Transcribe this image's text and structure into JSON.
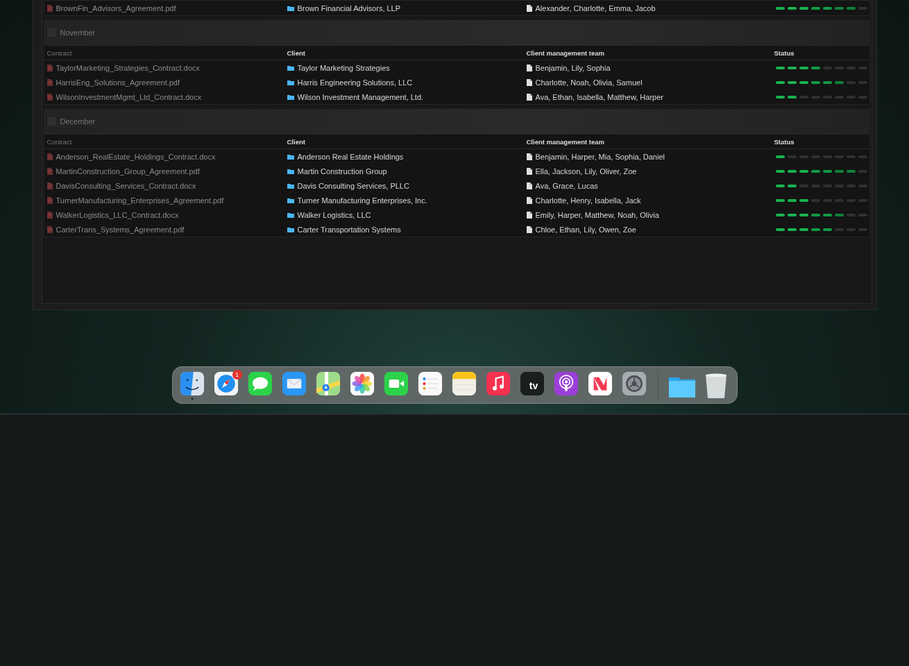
{
  "groups": [
    {
      "rows": [
        {
          "contract": "BrownFin_Advisors_Agreement.pdf",
          "client": "Brown Financial Advisors, LLP",
          "team": "Alexander, Charlotte, Emma, Jacob",
          "level": 0.875
        }
      ]
    },
    {
      "title": "November",
      "checked": false,
      "columns": [
        "Contract",
        "Client",
        "Client management team",
        "Status"
      ],
      "rows": [
        {
          "contract": "TaylorMarketing_Strategies_Contract.docx",
          "client": "Taylor Marketing Strategies",
          "team": "Benjamin, Lily, Sophia",
          "level": 0.5
        },
        {
          "contract": "HarrisEng_Solutions_Agreement.pdf",
          "client": "Harris Engineering Solutions, LLC",
          "team": "Charlotte, Noah, Olivia, Samuel",
          "level": 0.75
        },
        {
          "contract": "WilsonInvestmentMgmt_Ltd_Contract.docx",
          "client": "Wilson Investment Management, Ltd.",
          "team": "Ava, Ethan, Isabella, Matthew, Harper",
          "level": 0.25
        }
      ]
    },
    {
      "title": "December",
      "checked": false,
      "columns": [
        "Contract",
        "Client",
        "Client management team",
        "Status"
      ],
      "rows": [
        {
          "contract": "Anderson_RealEstate_Holdings_Contract.docx",
          "client": "Anderson Real Estate Holdings",
          "team": "Benjamin, Harper, Mia, Sophia, Daniel",
          "level": 0.125
        },
        {
          "contract": "MartinConstruction_Group_Agreement.pdf",
          "client": "Martin Construction Group",
          "team": "Ella, Jackson, Lily, Oliver, Zoe",
          "level": 0.875
        },
        {
          "contract": "DavisConsulting_Services_Contract.docx",
          "client": "Davis Consulting Services, PLLC",
          "team": "Ava, Grace, Lucas",
          "level": 0.25
        },
        {
          "contract": "TurnerManufacturing_Enterprises_Agreement.pdf",
          "client": "Turner Manufacturing Enterprises, Inc.",
          "team": "Charlotte, Henry, Isabella, Jack",
          "level": 0.375
        },
        {
          "contract": "WalkerLogistics_LLC_Contract.docx",
          "client": "Walker Logistics, LLC",
          "team": "Emily, Harper, Matthew, Noah, Olivia",
          "level": 0.75
        },
        {
          "contract": "CarterTrans_Systems_Agreement.pdf",
          "client": "Carter Transportation Systems",
          "team": "Chloe, Ethan, Lily, Owen, Zoe",
          "level": 0.625
        }
      ]
    }
  ],
  "dock": {
    "apps": [
      {
        "kind": "finder",
        "running": true
      },
      {
        "kind": "safari",
        "running": false,
        "badge": "1"
      },
      {
        "kind": "messages",
        "running": false
      },
      {
        "kind": "mail",
        "running": false
      },
      {
        "kind": "maps",
        "running": false
      },
      {
        "kind": "photos",
        "running": false
      },
      {
        "kind": "facetime",
        "running": false
      },
      {
        "kind": "reminders",
        "running": false
      },
      {
        "kind": "notes",
        "running": false
      },
      {
        "kind": "music",
        "running": false
      },
      {
        "kind": "tv",
        "running": false,
        "label": "tv"
      },
      {
        "kind": "podcasts",
        "running": false
      },
      {
        "kind": "news",
        "running": false
      },
      {
        "kind": "settings",
        "running": false
      }
    ],
    "stacks": [
      {
        "kind": "folder"
      },
      {
        "kind": "trash"
      }
    ]
  }
}
